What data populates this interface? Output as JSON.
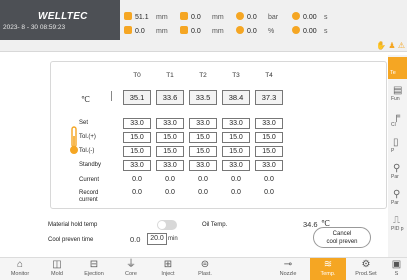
{
  "header": {
    "logo": "WELLTEC",
    "datetime": "2023- 8 - 30 08:59:23",
    "stats": [
      {
        "icon": "screw-position-icon",
        "value": "51.1",
        "unit": "mm"
      },
      {
        "icon": "mold-position-icon",
        "value": "0.0",
        "unit": "mm"
      },
      {
        "icon": "pressure-icon",
        "value": "0.0",
        "unit": "bar"
      },
      {
        "icon": "cycle-time-icon",
        "value": "0.00",
        "unit": "s"
      },
      {
        "icon": "ejector-position-icon",
        "value": "0.0",
        "unit": "mm"
      },
      {
        "icon": "injection-position-icon",
        "value": "0.0",
        "unit": "mm"
      },
      {
        "icon": "speed-icon",
        "value": "0.0",
        "unit": "%"
      },
      {
        "icon": "auto-time-icon",
        "value": "0.00",
        "unit": "s"
      }
    ]
  },
  "temp": {
    "unit_symbol": "℃",
    "columns": [
      "T0",
      "T1",
      "T2",
      "T3",
      "T4"
    ],
    "actual": [
      "35.1",
      "33.6",
      "33.5",
      "38.4",
      "37.3"
    ],
    "rows": [
      {
        "label": "Set",
        "values": [
          "33.0",
          "33.0",
          "33.0",
          "33.0",
          "33.0"
        ]
      },
      {
        "label": "Tol.(+)",
        "values": [
          "15.0",
          "15.0",
          "15.0",
          "15.0",
          "15.0"
        ]
      },
      {
        "label": "Tol.(-)",
        "values": [
          "15.0",
          "15.0",
          "15.0",
          "15.0",
          "15.0"
        ]
      },
      {
        "label": "Standby",
        "values": [
          "33.0",
          "33.0",
          "33.0",
          "33.0",
          "33.0"
        ]
      }
    ],
    "current_label": "Current",
    "current_values": [
      "0.0",
      "0.0",
      "0.0",
      "0.0",
      "0.0"
    ],
    "record_label_1": "Record",
    "record_label_2": "current",
    "record_values": [
      "0.0",
      "0.0",
      "0.0",
      "0.0",
      "0.0"
    ]
  },
  "controls": {
    "material_hold_label": "Material hold temp",
    "oil_temp_label": "Oil Temp.",
    "oil_temp_value": "34.6",
    "oil_temp_unit": "℃",
    "cool_preven_label": "Cool preven time",
    "cool_preven_value": "0.0",
    "cool_preven_input": "20.0",
    "cool_preven_unit": "min",
    "cancel_line1": "Cancel",
    "cancel_line2": "cool preven"
  },
  "sidebar": {
    "active": "Te",
    "items": [
      "Fun",
      "Cl",
      "P",
      "Par",
      "Par",
      "PID p"
    ]
  },
  "nav": [
    {
      "label": "Monitor",
      "icon": "home-icon"
    },
    {
      "label": "Mold",
      "icon": "mold-icon"
    },
    {
      "label": "Ejection",
      "icon": "ejection-icon"
    },
    {
      "label": "Core",
      "icon": "core-icon"
    },
    {
      "label": "Inject",
      "icon": "inject-icon"
    },
    {
      "label": "Plast.",
      "icon": "plast-icon"
    },
    {
      "label": "Nozzle",
      "icon": "nozzle-icon"
    },
    {
      "label": "Temp.",
      "icon": "temp-icon"
    },
    {
      "label": "Prod.Set",
      "icon": "prod-set-icon"
    },
    {
      "label": "S",
      "icon": "system-icon"
    }
  ],
  "colors": {
    "accent": "#f5a623",
    "header_dark": "#4d5055"
  }
}
